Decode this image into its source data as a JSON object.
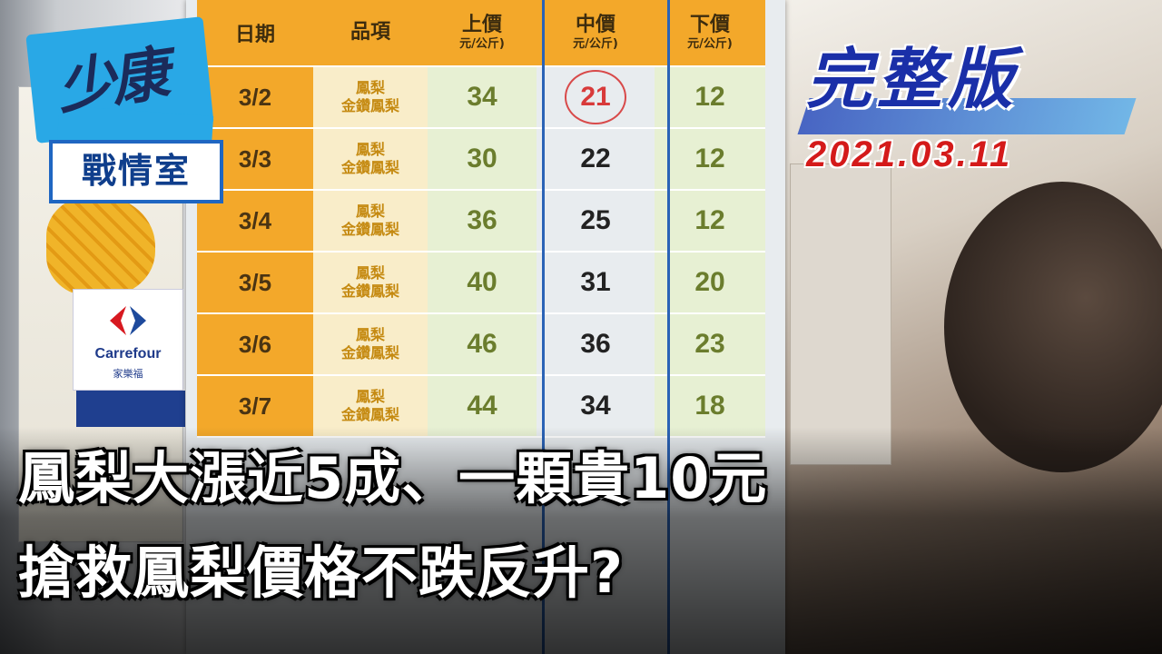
{
  "logo": {
    "script_text": "少康",
    "label": "戰情室"
  },
  "edition": {
    "label": "完整版",
    "date": "2021.03.11"
  },
  "carrefour": {
    "name": "Carrefour",
    "sub": "家樂福"
  },
  "price_table": {
    "headers": {
      "date": "日期",
      "item": "品項",
      "upper": {
        "title": "上價",
        "sub_a": "(單位:",
        "sub_b": "元/公斤)"
      },
      "middle": {
        "title": "中價",
        "sub_a": "(單位:",
        "sub_b": "元/公斤)"
      },
      "lower": {
        "title": "下價",
        "sub_a": "(單位:",
        "sub_b": "元/公斤)"
      }
    },
    "rows": [
      {
        "date": "3/2",
        "item_a": "鳳梨",
        "item_b": "金鑽鳳梨",
        "upper": "34",
        "middle": "21",
        "lower": "12"
      },
      {
        "date": "3/3",
        "item_a": "鳳梨",
        "item_b": "金鑽鳳梨",
        "upper": "30",
        "middle": "22",
        "lower": "12"
      },
      {
        "date": "3/4",
        "item_a": "鳳梨",
        "item_b": "金鑽鳳梨",
        "upper": "36",
        "middle": "25",
        "lower": "12"
      },
      {
        "date": "3/5",
        "item_a": "鳳梨",
        "item_b": "金鑽鳳梨",
        "upper": "40",
        "middle": "31",
        "lower": "20"
      },
      {
        "date": "3/6",
        "item_a": "鳳梨",
        "item_b": "金鑽鳳梨",
        "upper": "46",
        "middle": "36",
        "lower": "23"
      },
      {
        "date": "3/7",
        "item_a": "鳳梨",
        "item_b": "金鑽鳳梨",
        "upper": "44",
        "middle": "34",
        "lower": "18"
      }
    ]
  },
  "caption": {
    "line1": "鳳梨大漲近5成、一顆貴10元",
    "line2": "搶救鳳梨價格不跌反升?"
  },
  "colors": {
    "header_orange": "#f3a82a",
    "edition_blue": "#1a2fa8",
    "edition_red": "#d41a1a",
    "highlight_red": "#d83a3a"
  }
}
